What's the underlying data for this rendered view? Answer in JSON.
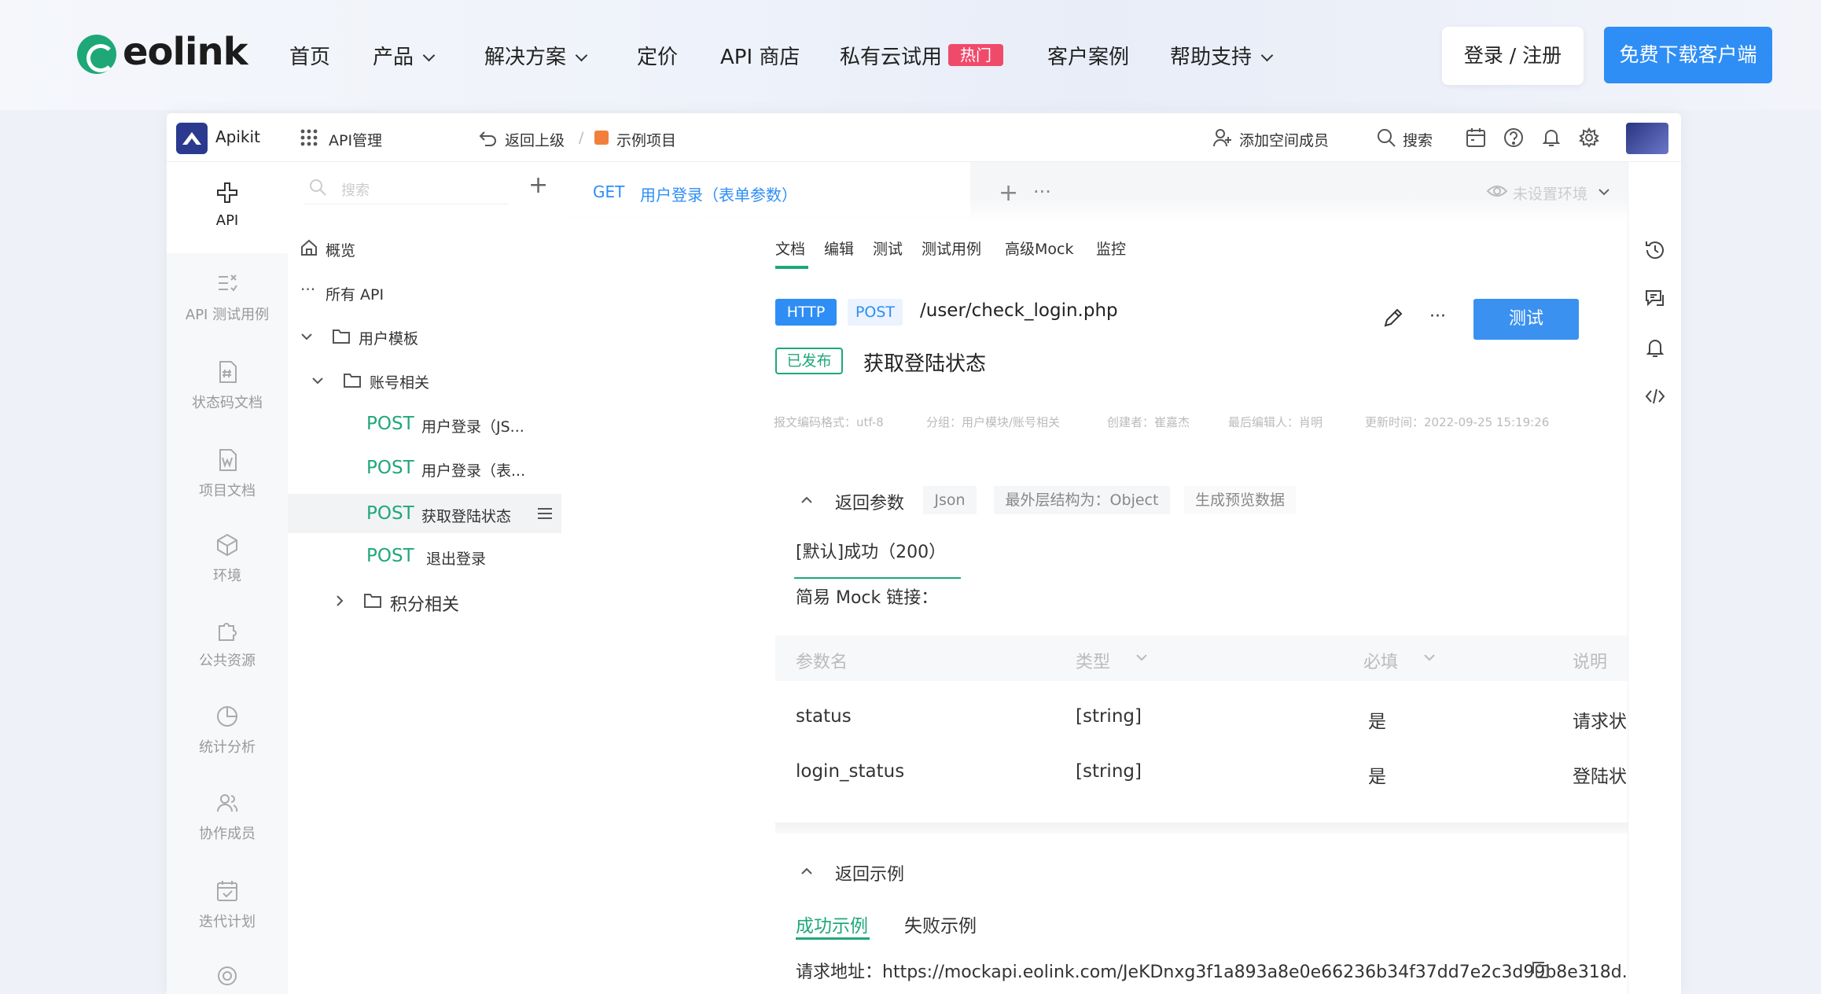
{
  "topnav": {
    "brand": "eolink",
    "items": [
      "首页",
      "产品",
      "解决方案",
      "定价",
      "API 商店",
      "私有云试用",
      "客户案例",
      "帮助支持"
    ],
    "hot_badge": "热门",
    "login_label": "登录 / 注册",
    "download_label": "免费下载客户端"
  },
  "app_header": {
    "app_name": "Apikit",
    "module": "API管理",
    "back": "返回上级",
    "project": "示例项目",
    "add_member": "添加空间成员",
    "search": "搜索"
  },
  "rail": {
    "items": [
      "API",
      "API 测试用例",
      "状态码文档",
      "项目文档",
      "环境",
      "公共资源",
      "统计分析",
      "协作成员",
      "迭代计划"
    ]
  },
  "tree": {
    "search_placeholder": "搜索",
    "overview": "概览",
    "all_api": "所有 API",
    "group_user_template": "用户模板",
    "group_account": "账号相关",
    "apis": [
      {
        "method": "POST",
        "name": "用户登录（JS..."
      },
      {
        "method": "POST",
        "name": "用户登录（表..."
      },
      {
        "method": "POST",
        "name": "获取登陆状态"
      },
      {
        "method": "POST",
        "name": "退出登录"
      }
    ],
    "group_points": "积分相关"
  },
  "tabbar": {
    "active_tab_method": "GET",
    "active_tab_name": "用户登录（表单参数）",
    "env_placeholder": "未设置环境"
  },
  "subtabs": [
    "文档",
    "编辑",
    "测试",
    "测试用例",
    "高级Mock",
    "监控"
  ],
  "api": {
    "protocol": "HTTP",
    "method": "POST",
    "path": "/user/check_login.php",
    "status": "已发布",
    "name": "获取登陆状态",
    "test_label": "测试",
    "meta": [
      "报文编码格式：utf-8",
      "分组：用户模块/账号相关",
      "创建者：崔嘉杰",
      "最后编辑人：肖明",
      "更新时间：2022-09-25 15:19:26"
    ]
  },
  "response": {
    "title": "返回参数",
    "format": "Json",
    "outer_structure": "最外层结构为：Object",
    "preview": "生成预览数据",
    "default_tab": "[默认]成功（200）",
    "mock_label": "简易 Mock 链接：",
    "columns": [
      "参数名",
      "类型",
      "必填",
      "说明"
    ],
    "rows": [
      [
        "status",
        "[string]",
        "是",
        "请求状态"
      ],
      [
        "login_status",
        "[string]",
        "是",
        "登陆状态"
      ]
    ]
  },
  "example": {
    "title": "返回示例",
    "tabs": [
      "成功示例",
      "失败示例"
    ],
    "request_url": "请求地址：https://mockapi.eolink.com/JeKDnxg3f1a893a8e0e66236b34f37dd7e2c3d99b8e318d..."
  },
  "colors": {
    "accent": "#2e8ef5",
    "green": "#1fa877",
    "hot": "#f04a6b"
  }
}
